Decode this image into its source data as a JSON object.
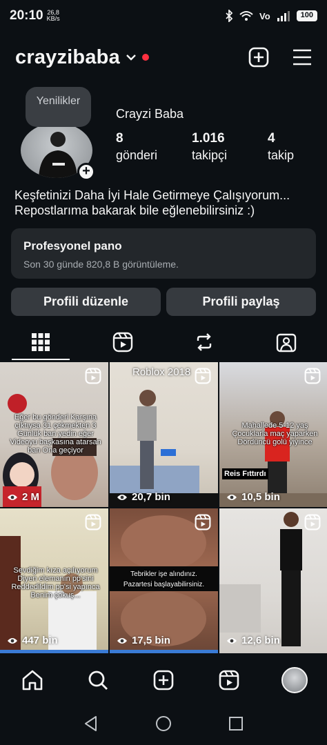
{
  "status_bar": {
    "time": "20:10",
    "speed_value": "26,8",
    "speed_unit": "KB/s",
    "network": "Vo",
    "battery": "100"
  },
  "header": {
    "username": "crayzibaba"
  },
  "profile": {
    "note": "Yenilikler",
    "display_name": "Crayzi Baba",
    "stats": [
      {
        "value": "8",
        "label": "gönderi"
      },
      {
        "value": "1.016",
        "label": "takipçi"
      },
      {
        "value": "4",
        "label": "takip"
      }
    ],
    "bio_line1": "Keşfetinizi Daha İyi Hale Getirmeye Çalışıyorum...",
    "bio_line2": "Repostlarıma bakarak bile eğlenebilirsiniz :)"
  },
  "dashboard": {
    "title": "Profesyonel pano",
    "subtitle": "Son 30 günde 820,8 B görüntüleme."
  },
  "buttons": {
    "edit": "Profili düzenle",
    "share": "Profili paylaş"
  },
  "grid": {
    "watermark": "Roblox 2018",
    "posts": [
      {
        "views": "2 M",
        "caption": "Eğer bu gönderi Karşına çıktıysa 31 çekmekten 3 Günlük ban yedin eğer Videoyu başkasına atarsan ban Ona geçiyor"
      },
      {
        "views": "20,7 bin",
        "caption": ""
      },
      {
        "views": "10,5 bin",
        "caption": "Mahallede 5-12 yaş Çocuklarla maç yaparken Dördüncü golü yiyince",
        "tag": "Reis Fıttırdı"
      },
      {
        "views": "447 bin",
        "caption": "Sevdiğim kıza açılıyorum Diyen elemanın pp'sini Reddedildim pp'si yapınca Benim çokuş..."
      },
      {
        "views": "17,5 bin",
        "caption": "Tebrikler işe alındınız. Pazartesi başlayabilirsiniz."
      },
      {
        "views": "12,6 bin",
        "caption": ""
      }
    ]
  }
}
